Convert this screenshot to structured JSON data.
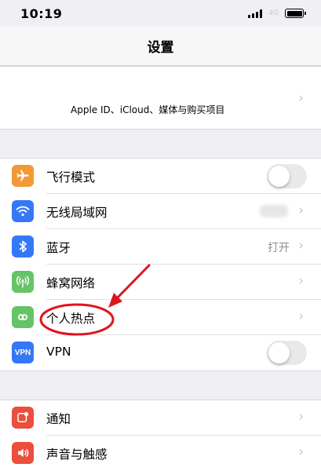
{
  "status_bar": {
    "time": "10:19",
    "network_label": "4G"
  },
  "nav": {
    "title": "设置"
  },
  "apple_id": {
    "label": "Apple ID、iCloud、媒体与购买项目"
  },
  "network_group": [
    {
      "label": "飞行模式",
      "icon": "airplane-icon",
      "color": "#f09a37",
      "accessory": "toggle",
      "toggle_on": false
    },
    {
      "label": "无线局域网",
      "icon": "wifi-icon",
      "color": "#3478f6",
      "accessory": "blurred-detail"
    },
    {
      "label": "蓝牙",
      "icon": "bluetooth-icon",
      "color": "#3478f6",
      "accessory": "detail",
      "detail": "打开"
    },
    {
      "label": "蜂窝网络",
      "icon": "cellular-icon",
      "color": "#65c466",
      "accessory": "chevron"
    },
    {
      "label": "个人热点",
      "icon": "hotspot-icon",
      "color": "#65c466",
      "accessory": "chevron"
    },
    {
      "label": "VPN",
      "icon": "vpn-icon",
      "color": "#3478f6",
      "accessory": "toggle",
      "toggle_on": false,
      "badge": "VPN"
    }
  ],
  "notify_group": [
    {
      "label": "通知",
      "icon": "notifications-icon",
      "color": "#eb4e3d",
      "accessory": "chevron"
    },
    {
      "label": "声音与触感",
      "icon": "sounds-icon",
      "color": "#eb4e3d",
      "accessory": "chevron"
    }
  ],
  "colors": {
    "annotation": "#e0141e",
    "chevron": "#c7c7cc",
    "background": "#efeff4"
  }
}
